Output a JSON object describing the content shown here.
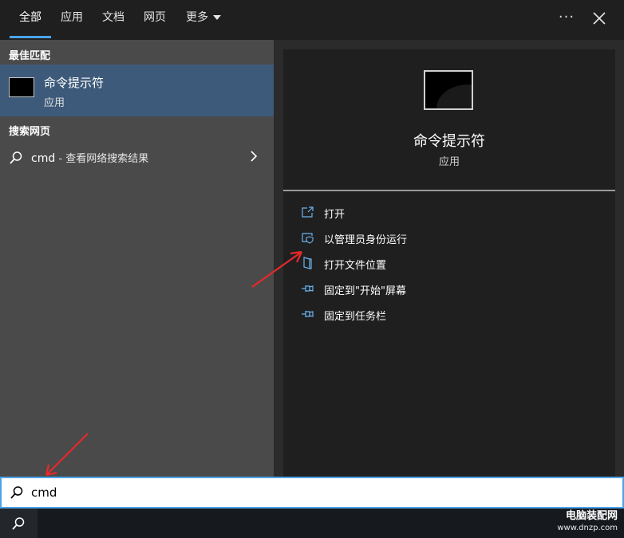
{
  "tabs": [
    {
      "label": "全部",
      "active": true
    },
    {
      "label": "应用"
    },
    {
      "label": "文档"
    },
    {
      "label": "网页"
    },
    {
      "label": "更多"
    }
  ],
  "header_icons": {
    "more": "more-options-icon",
    "close": "close-icon"
  },
  "left": {
    "best_match_heading": "最佳匹配",
    "best_match": {
      "title": "命令提示符",
      "subtitle": "应用",
      "icon": "command-prompt-icon"
    },
    "web_heading": "搜索网页",
    "web_result": {
      "query": "cmd",
      "suffix": " - 查看网络搜索结果",
      "icon": "search-icon",
      "chevron": "chevron-right-icon"
    }
  },
  "right": {
    "app_name": "命令提示符",
    "app_type": "应用",
    "actions": [
      {
        "label": "打开",
        "icon": "open-icon"
      },
      {
        "label": "以管理员身份运行",
        "icon": "run-as-admin-shield-icon"
      },
      {
        "label": "打开文件位置",
        "icon": "file-location-icon"
      },
      {
        "label": "固定到\"开始\"屏幕",
        "icon": "pin-icon"
      },
      {
        "label": "固定到任务栏",
        "icon": "pin-icon"
      }
    ]
  },
  "search": {
    "value": "cmd",
    "icon": "search-icon"
  },
  "watermark": {
    "title": "电脑装配网",
    "url": "www.dnzp.com"
  },
  "colors": {
    "accent": "#4ca3e8",
    "selected_row": "#3d5a7a",
    "annotation_arrow": "#e8282b"
  }
}
